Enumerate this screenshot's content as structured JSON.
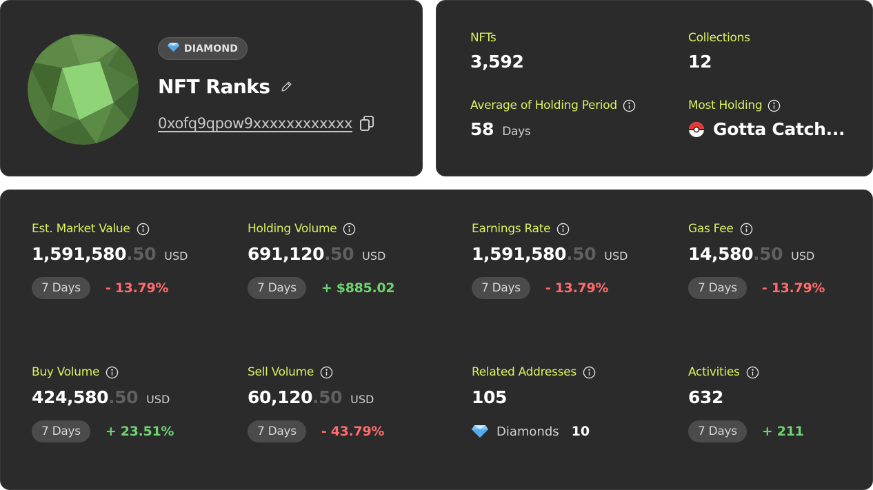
{
  "profile": {
    "tier": "DIAMOND",
    "name": "NFT Ranks",
    "address": "0xofq9qpow9xxxxxxxxxxxx"
  },
  "summary": {
    "nfts": {
      "label": "NFTs",
      "value": "3,592"
    },
    "collections": {
      "label": "Collections",
      "value": "12"
    },
    "holding_period": {
      "label": "Average of Holding Period",
      "value": "58",
      "unit": "Days"
    },
    "most_holding": {
      "label": "Most Holding",
      "value": "Gotta Catch..."
    }
  },
  "stats": [
    {
      "label": "Est. Market Value",
      "int": "1,591,580",
      "dec": ".50",
      "unit": "USD",
      "period": "7 Days",
      "change": "- 13.79%",
      "trend": "neg"
    },
    {
      "label": "Holding Volume",
      "int": "691,120",
      "dec": ".50",
      "unit": "USD",
      "period": "7 Days",
      "change": "+ $885.02",
      "trend": "pos"
    },
    {
      "label": "Earnings Rate",
      "int": "1,591,580",
      "dec": ".50",
      "unit": "USD",
      "period": "7 Days",
      "change": "- 13.79%",
      "trend": "neg"
    },
    {
      "label": "Gas Fee",
      "int": "14,580",
      "dec": ".50",
      "unit": "USD",
      "period": "7 Days",
      "change": "- 13.79%",
      "trend": "neg"
    },
    {
      "label": "Buy Volume",
      "int": "424,580",
      "dec": ".50",
      "unit": "USD",
      "period": "7 Days",
      "change": "+ 23.51%",
      "trend": "pos"
    },
    {
      "label": "Sell Volume",
      "int": "60,120",
      "dec": ".50",
      "unit": "USD",
      "period": "7 Days",
      "change": "- 43.79%",
      "trend": "neg"
    },
    {
      "label": "Related Addresses",
      "int": "105",
      "diamonds_label": "Diamonds",
      "diamonds_count": "10"
    },
    {
      "label": "Activities",
      "int": "632",
      "period": "7 Days",
      "change": "+ 211",
      "trend": "pos"
    }
  ],
  "colors": {
    "card_bg": "#2b2b2b",
    "accent_label": "#d7f25e",
    "negative": "#ff6b6b",
    "positive": "#6fd36f"
  }
}
